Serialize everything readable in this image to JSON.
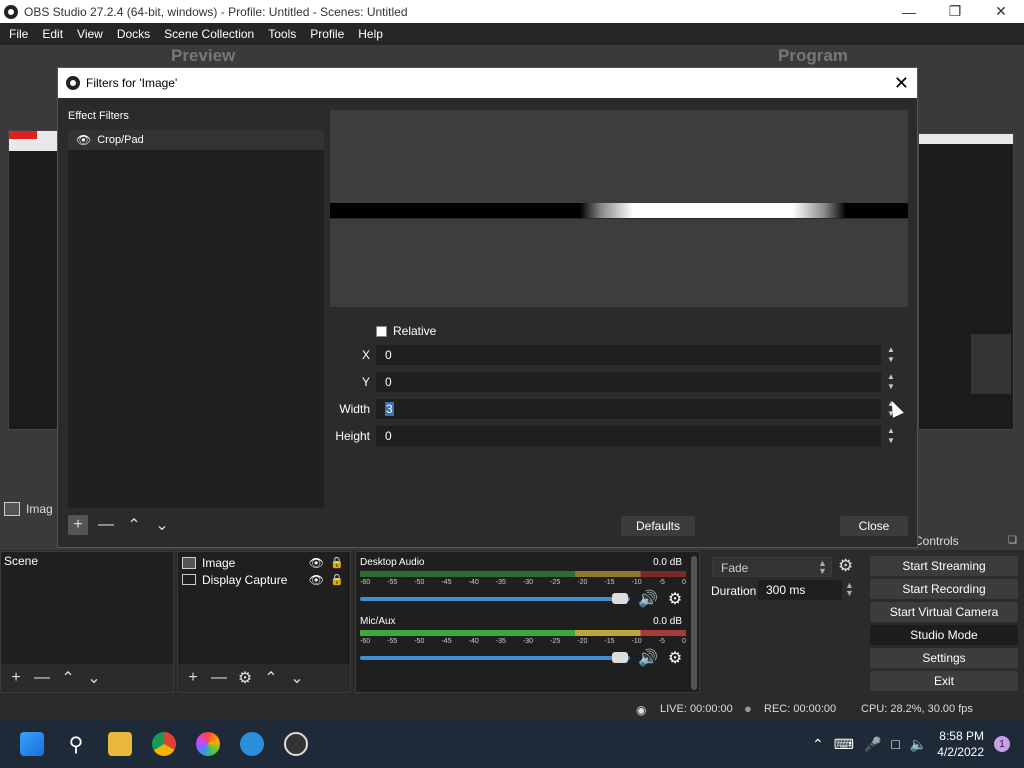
{
  "window": {
    "title": "OBS Studio 27.2.4 (64-bit, windows) - Profile: Untitled - Scenes: Untitled"
  },
  "menu": [
    "File",
    "Edit",
    "View",
    "Docks",
    "Scene Collection",
    "Tools",
    "Profile",
    "Help"
  ],
  "studio": {
    "preview_label": "Preview",
    "program_label": "Program"
  },
  "background_source": "Imag",
  "dialog": {
    "title": "Filters for 'Image'",
    "effect_filters_label": "Effect Filters",
    "filters": [
      "Crop/Pad"
    ],
    "relative_label": "Relative",
    "fields": [
      {
        "label": "X",
        "value": "0"
      },
      {
        "label": "Y",
        "value": "0"
      },
      {
        "label": "Width",
        "value": "3"
      },
      {
        "label": "Height",
        "value": "0"
      }
    ],
    "defaults_label": "Defaults",
    "close_label": "Close"
  },
  "docks": {
    "scenes_header": "Scene",
    "controls_header": "Controls",
    "sources": [
      "Image",
      "Display Capture"
    ],
    "mixer": [
      {
        "name": "Desktop Audio",
        "db": "0.0 dB",
        "level": 0.0
      },
      {
        "name": "Mic/Aux",
        "db": "0.0 dB",
        "level": 1.0
      }
    ],
    "meter_ticks": [
      "-60",
      "-55",
      "-50",
      "-45",
      "-40",
      "-35",
      "-30",
      "-25",
      "-20",
      "-15",
      "-10",
      "-5",
      "0"
    ],
    "transition": "Fade",
    "duration_label": "Duration",
    "duration_value": "300 ms",
    "controls": [
      "Start Streaming",
      "Start Recording",
      "Start Virtual Camera",
      "Studio Mode",
      "Settings",
      "Exit"
    ]
  },
  "status": {
    "live": "LIVE: 00:00:00",
    "rec": "REC: 00:00:00",
    "cpu": "CPU: 28.2%, 30.00 fps"
  },
  "taskbar": {
    "time": "8:58 PM",
    "date": "4/2/2022",
    "notifications": "1"
  }
}
